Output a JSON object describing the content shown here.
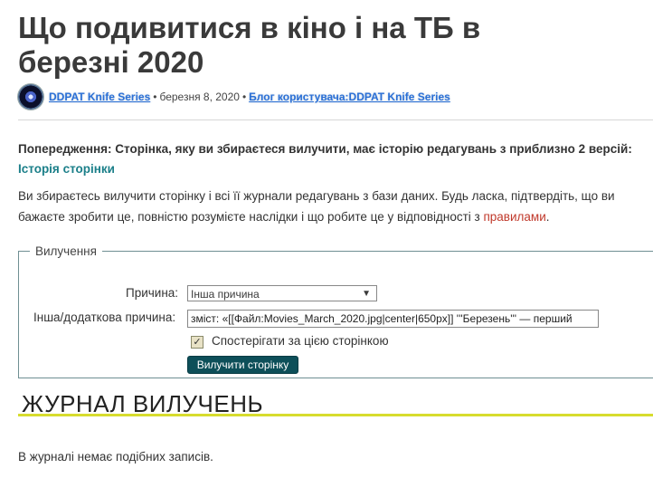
{
  "page": {
    "title": "Що подивитися в кіно і на ТБ в березні 2020"
  },
  "meta": {
    "author": "DDPAT Knife Series",
    "date": "березня 8, 2020",
    "separator": "•",
    "blog_link": "Блог користувача:DDPAT Knife Series"
  },
  "warning": {
    "text": "Попередження: Сторінка, яку ви збираєтеся вилучити, має історію редагувань з приблизно 2 версій:",
    "link": "Історія сторінки"
  },
  "info": {
    "text": "Ви збираєтесь вилучити сторінку і всі її журнали редагувань з бази даних. Будь ласка, підтвердіть, що ви бажаєте зробити це, повністю розумієте наслідки і що робите це у відповідності з",
    "link": "правилами",
    "end": "."
  },
  "form": {
    "legend": "Вилучення",
    "reason_label": "Причина:",
    "reason_value": "Інша причина",
    "other_label": "Інша/додаткова причина:",
    "other_value": "зміст: «[[Файл:Movies_March_2020.jpg|center|650px]] '''Березень''' — перший",
    "watch_label": "Спостерігати за цією сторінкою",
    "watch_checked": true,
    "submit_label": "Вилучити сторінку",
    "caret": "▼",
    "check_mark": "✓"
  },
  "log": {
    "heading": "ЖУРНАЛ ВИЛУЧЕНЬ",
    "empty_text": "В журналі немає подібних записів."
  },
  "colors": {
    "link": "#2a6fd6",
    "accent": "#1b7f89",
    "rules_link": "#c0392b",
    "button": "#0d4f59",
    "underline": "#d7dc2e"
  }
}
